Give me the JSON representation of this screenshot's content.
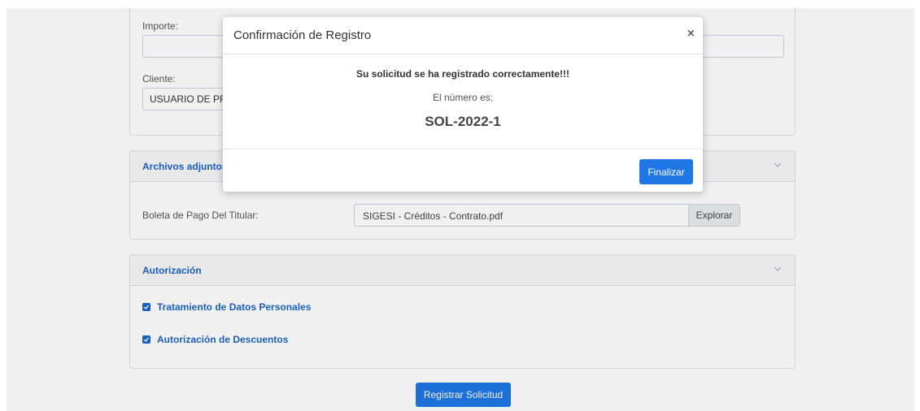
{
  "form": {
    "importe_label": "Importe:",
    "importe_value": "",
    "cliente_label": "Cliente:",
    "cliente_value": "USUARIO DE PR"
  },
  "attachments": {
    "title": "Archivos adjuntos",
    "field_label": "Boleta de Pago Del Titular:",
    "file_name": "SIGESI - Créditos - Contrato.pdf",
    "browse_label": "Explorar"
  },
  "authorization": {
    "title": "Autorización",
    "items": [
      {
        "label": "Tratamiento de Datos Personales",
        "checked": true
      },
      {
        "label": "Autorización de Descuentos",
        "checked": true
      }
    ]
  },
  "submit_label": "Registrar Solicitud",
  "modal": {
    "title": "Confirmación de Registro",
    "close_glyph": "×",
    "message": "Su solicitud se ha registrado correctamente!!!",
    "sub_message": "El número es:",
    "request_number": "SOL-2022-1",
    "button_label": "Finalizar"
  },
  "colors": {
    "primary": "#1f78e6",
    "header_text": "#1a66c8",
    "card_border": "#dfe2e6"
  }
}
